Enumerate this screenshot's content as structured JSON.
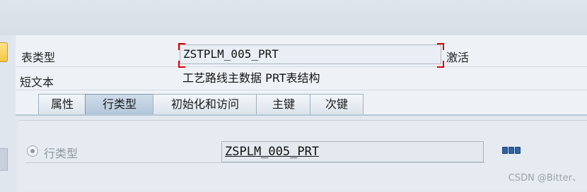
{
  "header": {
    "table_type_label": "表类型",
    "table_type_value": "ZSTPLM_005_PRT",
    "status": "激活",
    "short_text_label": "短文本",
    "short_text_value": "工艺路线主数据 PRT表结构"
  },
  "tabs": [
    {
      "label": "属性",
      "active": false
    },
    {
      "label": "行类型",
      "active": true
    },
    {
      "label": "初始化和访问",
      "active": false
    },
    {
      "label": "主键",
      "active": false
    },
    {
      "label": "次键",
      "active": false
    }
  ],
  "line_type": {
    "radio_label": "行类型",
    "value": "ZSPLM_005_PRT"
  },
  "icons": {
    "detail": "table-detail-icon"
  },
  "colors": {
    "focus_corner": "#d40000",
    "active_tab": "#b3c6d9"
  },
  "watermark": "CSDN @Bitter、"
}
